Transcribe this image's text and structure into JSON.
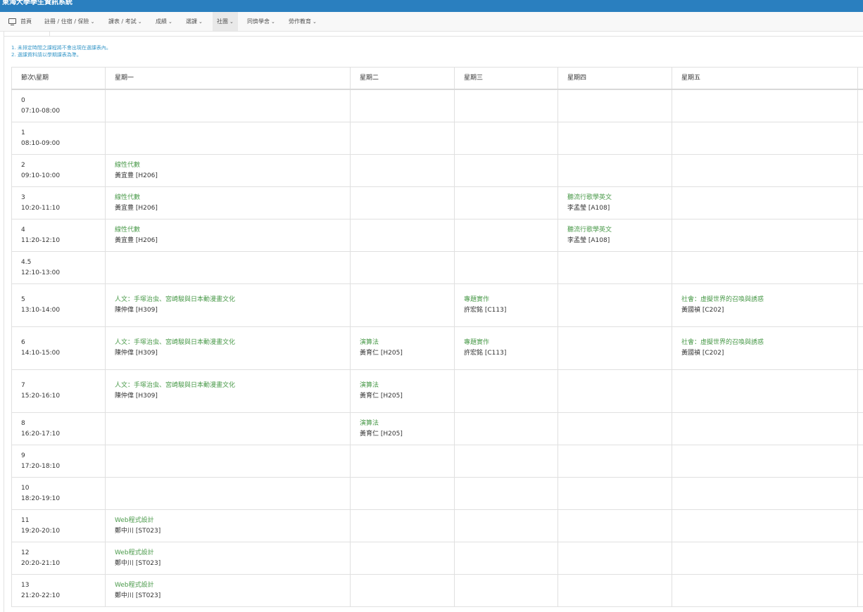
{
  "app": {
    "title": "東海大學學生資訊系統"
  },
  "nav": {
    "home": "首頁",
    "items": [
      "註冊 / 住宿 / 保險",
      "課表 / 考試",
      "成績",
      "選課",
      "社團",
      "同儕學舍",
      "勞作教育"
    ]
  },
  "notes": [
    "1. 未排定時間之課程將不會出現在選課表內。",
    "2. 選課資料請以學期課表為準。"
  ],
  "table": {
    "headers": [
      "節次\\星期",
      "星期一",
      "星期二",
      "星期三",
      "星期四",
      "星期五"
    ],
    "rows": [
      {
        "period": "0",
        "time": "07:10-08:00",
        "cells": [
          null,
          null,
          null,
          null,
          null
        ]
      },
      {
        "period": "1",
        "time": "08:10-09:00",
        "cells": [
          null,
          null,
          null,
          null,
          null
        ]
      },
      {
        "period": "2",
        "time": "09:10-10:00",
        "cells": [
          {
            "course": "線性代數",
            "teacher": "黃宜豊 [H206]"
          },
          null,
          null,
          null,
          null
        ]
      },
      {
        "period": "3",
        "time": "10:20-11:10",
        "cells": [
          {
            "course": "線性代數",
            "teacher": "黃宜豊 [H206]"
          },
          null,
          null,
          {
            "course": "聽流行歌學英文",
            "teacher": "李孟瑩 [A108]"
          },
          null
        ]
      },
      {
        "period": "4",
        "time": "11:20-12:10",
        "cells": [
          {
            "course": "線性代數",
            "teacher": "黃宜豊 [H206]"
          },
          null,
          null,
          {
            "course": "聽流行歌學英文",
            "teacher": "李孟瑩 [A108]"
          },
          null
        ]
      },
      {
        "period": "4.5",
        "time": "12:10-13:00",
        "cells": [
          null,
          null,
          null,
          null,
          null
        ]
      },
      {
        "period": "5",
        "time": "13:10-14:00",
        "tall": true,
        "cells": [
          {
            "course": "人文：手塚治虫、宮崎駿與日本動漫畫文化",
            "teacher": "陳仲偉 [H309]"
          },
          null,
          {
            "course": "專題實作",
            "teacher": "許宏銘 [C113]"
          },
          null,
          {
            "course": "社會：虛擬世界的召喚與誘惑",
            "teacher": "黃國禎 [C202]"
          }
        ]
      },
      {
        "period": "6",
        "time": "14:10-15:00",
        "tall": true,
        "cells": [
          {
            "course": "人文：手塚治虫、宮崎駿與日本動漫畫文化",
            "teacher": "陳仲偉 [H309]"
          },
          {
            "course": "演算法",
            "teacher": "黃育仁 [H205]"
          },
          {
            "course": "專題實作",
            "teacher": "許宏銘 [C113]"
          },
          null,
          {
            "course": "社會：虛擬世界的召喚與誘惑",
            "teacher": "黃國禎 [C202]"
          }
        ]
      },
      {
        "period": "7",
        "time": "15:20-16:10",
        "tall": true,
        "cells": [
          {
            "course": "人文：手塚治虫、宮崎駿與日本動漫畫文化",
            "teacher": "陳仲偉 [H309]"
          },
          {
            "course": "演算法",
            "teacher": "黃育仁 [H205]"
          },
          null,
          null,
          null
        ]
      },
      {
        "period": "8",
        "time": "16:20-17:10",
        "cells": [
          null,
          {
            "course": "演算法",
            "teacher": "黃育仁 [H205]"
          },
          null,
          null,
          null
        ]
      },
      {
        "period": "9",
        "time": "17:20-18:10",
        "cells": [
          null,
          null,
          null,
          null,
          null
        ]
      },
      {
        "period": "10",
        "time": "18:20-19:10",
        "cells": [
          null,
          null,
          null,
          null,
          null
        ]
      },
      {
        "period": "11",
        "time": "19:20-20:10",
        "cells": [
          {
            "course": "Web程式設計",
            "teacher": "鄭中川 [ST023]"
          },
          null,
          null,
          null,
          null
        ]
      },
      {
        "period": "12",
        "time": "20:20-21:10",
        "cells": [
          {
            "course": "Web程式設計",
            "teacher": "鄭中川 [ST023]"
          },
          null,
          null,
          null,
          null
        ]
      },
      {
        "period": "13",
        "time": "21:20-22:10",
        "cells": [
          {
            "course": "Web程式設計",
            "teacher": "鄭中川 [ST023]"
          },
          null,
          null,
          null,
          null
        ]
      }
    ]
  }
}
